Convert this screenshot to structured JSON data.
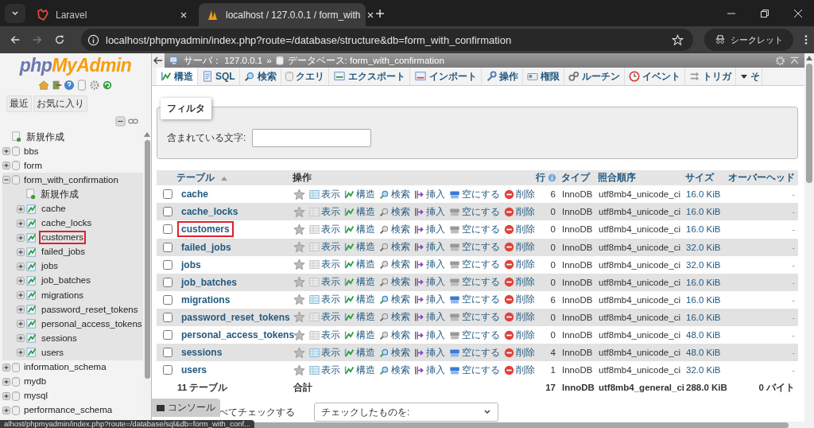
{
  "browser": {
    "tabs": [
      {
        "title": "Laravel",
        "selected": false
      },
      {
        "title": "localhost / 127.0.0.1 / form_with",
        "selected": true
      }
    ],
    "url": "localhost/phpmyadmin/index.php?route=/database/structure&db=form_with_confirmation",
    "incognito_label": "シークレット"
  },
  "sidebar": {
    "logo": {
      "part_1": "php",
      "part_2": "MyAdmin"
    },
    "buttons": [
      "最近",
      "お気に入り"
    ],
    "tree": [
      {
        "label": "新規作成",
        "kind": "new"
      },
      {
        "label": "bbs",
        "kind": "db",
        "expanded": false
      },
      {
        "label": "form",
        "kind": "db",
        "expanded": false
      },
      {
        "label": "form_with_confirmation",
        "kind": "db",
        "expanded": true,
        "children": [
          {
            "label": "新規作成",
            "kind": "new"
          },
          {
            "label": "cache",
            "kind": "table",
            "highlighted": false
          },
          {
            "label": "cache_locks",
            "kind": "table",
            "highlighted": false
          },
          {
            "label": "customers",
            "kind": "table",
            "highlighted": true
          },
          {
            "label": "failed_jobs",
            "kind": "table",
            "highlighted": false
          },
          {
            "label": "jobs",
            "kind": "table",
            "highlighted": false
          },
          {
            "label": "job_batches",
            "kind": "table",
            "highlighted": false
          },
          {
            "label": "migrations",
            "kind": "table",
            "highlighted": false
          },
          {
            "label": "password_reset_tokens",
            "kind": "table",
            "highlighted": false
          },
          {
            "label": "personal_access_tokens",
            "kind": "table",
            "highlighted": false
          },
          {
            "label": "sessions",
            "kind": "table",
            "highlighted": false
          },
          {
            "label": "users",
            "kind": "table",
            "highlighted": false
          }
        ]
      },
      {
        "label": "information_schema",
        "kind": "db",
        "expanded": false
      },
      {
        "label": "mydb",
        "kind": "db",
        "expanded": false
      },
      {
        "label": "mysql",
        "kind": "db",
        "expanded": false
      },
      {
        "label": "performance_schema",
        "kind": "db",
        "expanded": false
      }
    ]
  },
  "breadcrumb": {
    "server": "サーバ： 127.0.0.1",
    "separator": "»",
    "database": "データベース: form_with_confirmation"
  },
  "tabs": [
    {
      "label": "構造",
      "selected": true
    },
    {
      "label": "SQL",
      "selected": false
    },
    {
      "label": "検索",
      "selected": false
    },
    {
      "label": "クエリ",
      "selected": false
    },
    {
      "label": "エクスポート",
      "selected": false
    },
    {
      "label": "インポート",
      "selected": false
    },
    {
      "label": "操作",
      "selected": false
    },
    {
      "label": "権限",
      "selected": false
    },
    {
      "label": "ルーチン",
      "selected": false
    },
    {
      "label": "イベント",
      "selected": false
    },
    {
      "label": "トリガ",
      "selected": false
    },
    {
      "label": "そ",
      "selected": false
    }
  ],
  "filter": {
    "legend": "フィルタ",
    "label": "含まれている文字:"
  },
  "table": {
    "columns": [
      {
        "label": "テーブル",
        "sortable": true
      },
      {
        "label": "操作",
        "sortable": false
      },
      {
        "label": "行",
        "sortable": true
      },
      {
        "label": "タイプ",
        "sortable": true
      },
      {
        "label": "照合順序",
        "sortable": true
      },
      {
        "label": "サイズ",
        "sortable": true
      },
      {
        "label": "オーバーヘッド",
        "sortable": true
      }
    ],
    "rows": [
      {
        "name": "cache",
        "highlighted": false,
        "checked": false,
        "empty": false,
        "actions": [
          "表示",
          "構造",
          "検索",
          "挿入",
          "空にする",
          "削除"
        ],
        "rows": "6",
        "type": "InnoDB",
        "collation": "utf8mb4_unicode_ci",
        "size": "16.0 KiB",
        "overhead": "-"
      },
      {
        "name": "cache_locks",
        "highlighted": false,
        "checked": false,
        "empty": true,
        "actions": [
          "表示",
          "構造",
          "検索",
          "挿入",
          "空にする",
          "削除"
        ],
        "rows": "0",
        "type": "InnoDB",
        "collation": "utf8mb4_unicode_ci",
        "size": "16.0 KiB",
        "overhead": "-"
      },
      {
        "name": "customers",
        "highlighted": true,
        "checked": false,
        "empty": true,
        "actions": [
          "表示",
          "構造",
          "検索",
          "挿入",
          "空にする",
          "削除"
        ],
        "rows": "0",
        "type": "InnoDB",
        "collation": "utf8mb4_unicode_ci",
        "size": "16.0 KiB",
        "overhead": "-"
      },
      {
        "name": "failed_jobs",
        "highlighted": false,
        "checked": false,
        "empty": true,
        "actions": [
          "表示",
          "構造",
          "検索",
          "挿入",
          "空にする",
          "削除"
        ],
        "rows": "0",
        "type": "InnoDB",
        "collation": "utf8mb4_unicode_ci",
        "size": "32.0 KiB",
        "overhead": "-"
      },
      {
        "name": "jobs",
        "highlighted": false,
        "checked": false,
        "empty": true,
        "actions": [
          "表示",
          "構造",
          "検索",
          "挿入",
          "空にする",
          "削除"
        ],
        "rows": "0",
        "type": "InnoDB",
        "collation": "utf8mb4_unicode_ci",
        "size": "32.0 KiB",
        "overhead": "-"
      },
      {
        "name": "job_batches",
        "highlighted": false,
        "checked": false,
        "empty": true,
        "actions": [
          "表示",
          "構造",
          "検索",
          "挿入",
          "空にする",
          "削除"
        ],
        "rows": "0",
        "type": "InnoDB",
        "collation": "utf8mb4_unicode_ci",
        "size": "16.0 KiB",
        "overhead": "-"
      },
      {
        "name": "migrations",
        "highlighted": false,
        "checked": false,
        "empty": false,
        "actions": [
          "表示",
          "構造",
          "検索",
          "挿入",
          "空にする",
          "削除"
        ],
        "rows": "6",
        "type": "InnoDB",
        "collation": "utf8mb4_unicode_ci",
        "size": "16.0 KiB",
        "overhead": "-"
      },
      {
        "name": "password_reset_tokens",
        "highlighted": false,
        "checked": false,
        "empty": true,
        "actions": [
          "表示",
          "構造",
          "検索",
          "挿入",
          "空にする",
          "削除"
        ],
        "rows": "0",
        "type": "InnoDB",
        "collation": "utf8mb4_unicode_ci",
        "size": "16.0 KiB",
        "overhead": "-"
      },
      {
        "name": "personal_access_tokens",
        "highlighted": false,
        "checked": false,
        "empty": true,
        "actions": [
          "表示",
          "構造",
          "検索",
          "挿入",
          "空にする",
          "削除"
        ],
        "rows": "0",
        "type": "InnoDB",
        "collation": "utf8mb4_unicode_ci",
        "size": "48.0 KiB",
        "overhead": "-"
      },
      {
        "name": "sessions",
        "highlighted": false,
        "checked": false,
        "empty": false,
        "actions": [
          "表示",
          "構造",
          "検索",
          "挿入",
          "空にする",
          "削除"
        ],
        "rows": "4",
        "type": "InnoDB",
        "collation": "utf8mb4_unicode_ci",
        "size": "48.0 KiB",
        "overhead": "-"
      },
      {
        "name": "users",
        "highlighted": false,
        "checked": false,
        "empty": false,
        "actions": [
          "表示",
          "構造",
          "検索",
          "挿入",
          "空にする",
          "削除"
        ],
        "rows": "1",
        "type": "InnoDB",
        "collation": "utf8mb4_unicode_ci",
        "size": "32.0 KiB",
        "overhead": "-"
      }
    ],
    "footer": {
      "count": "11 テーブル",
      "label": "合計",
      "rows": "17",
      "type": "InnoDB",
      "collation": "utf8mb4_general_ci",
      "size": "288.0 KiB",
      "overhead": "0 バイト"
    }
  },
  "bottom": {
    "console": "コンソール",
    "check_all": "べてチェックする",
    "with_selected": "チェックしたものを:"
  },
  "status_bar": "alhost/phpmyadmin/index.php?route=/database/sql&db=form_with_conf..."
}
